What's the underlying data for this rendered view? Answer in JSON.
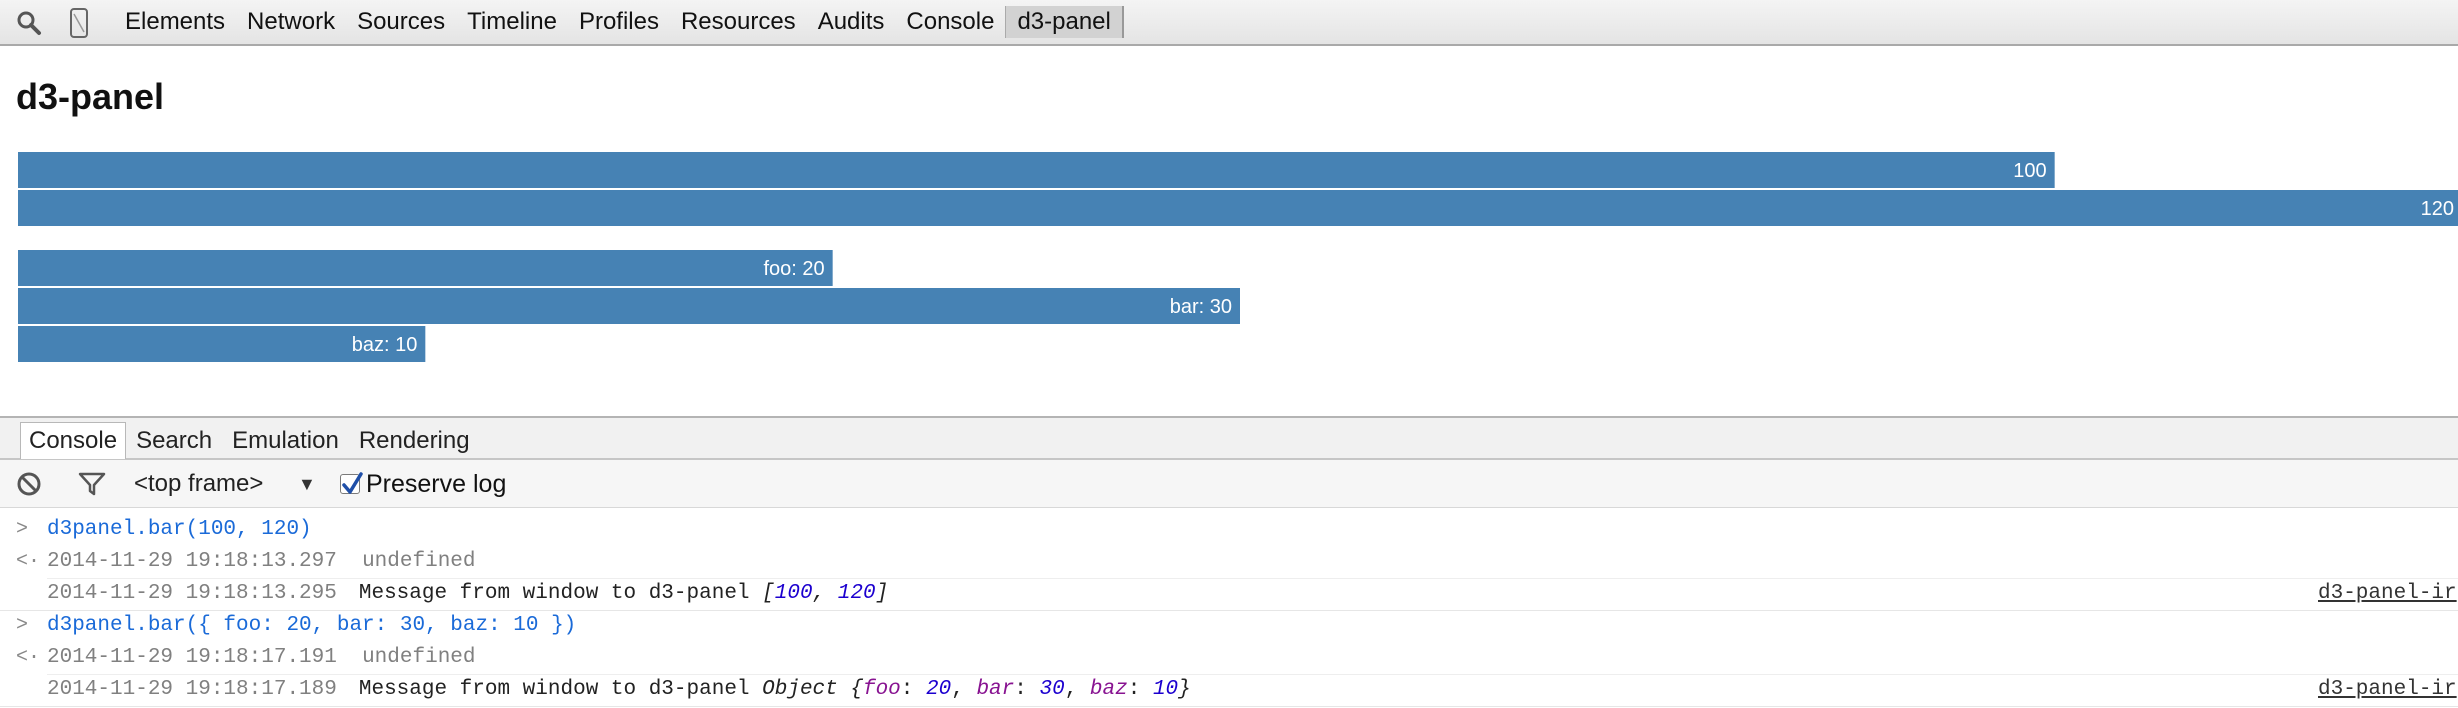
{
  "toolbar": {
    "icons": [
      "search-icon",
      "device-mode-icon"
    ],
    "tabs": [
      "Elements",
      "Network",
      "Sources",
      "Timeline",
      "Profiles",
      "Resources",
      "Audits",
      "Console",
      "d3-panel"
    ],
    "active_tab": "d3-panel"
  },
  "panel": {
    "title": "d3-panel"
  },
  "chart_data": [
    {
      "type": "bar",
      "orientation": "horizontal",
      "values": [
        100,
        120
      ],
      "labels": [
        "100",
        "120"
      ],
      "xlim": [
        0,
        120
      ],
      "bar_color": "#4682b4",
      "label_color": "#ffffff"
    },
    {
      "type": "bar",
      "orientation": "horizontal",
      "categories": [
        "foo",
        "bar",
        "baz"
      ],
      "values": [
        20,
        30,
        10
      ],
      "labels": [
        "foo: 20",
        "bar: 30",
        "baz: 10"
      ],
      "xlim": [
        0,
        60
      ],
      "bar_color": "#4682b4",
      "label_color": "#ffffff"
    }
  ],
  "drawer": {
    "tabs": [
      "Console",
      "Search",
      "Emulation",
      "Rendering"
    ],
    "active_tab": "Console"
  },
  "console_toolbar": {
    "clear_icon": "clear-console-icon",
    "filter_icon": "filter-icon",
    "frame_select": "<top frame>",
    "dropdown_arrow": "▼",
    "preserve_log_label": "Preserve log",
    "preserve_log_checked": true
  },
  "console": {
    "input_prompt": ">",
    "result_prompt": "<·",
    "messages": [
      {
        "kind": "input",
        "text": "d3panel.bar(100, 120)"
      },
      {
        "kind": "result",
        "timestamp": "2014-11-29 19:18:13.297",
        "text": "undefined"
      },
      {
        "kind": "log",
        "timestamp": "2014-11-29 19:18:13.295",
        "text": "Message from window to d3-panel",
        "arr_open": "[",
        "v1": "100",
        "comma": ", ",
        "v2": "120",
        "arr_close": "]",
        "source": "d3-panel-ir"
      },
      {
        "kind": "input",
        "text": "d3panel.bar({ foo: 20, bar: 30, baz: 10 })"
      },
      {
        "kind": "result",
        "timestamp": "2014-11-29 19:18:17.191",
        "text": "undefined"
      },
      {
        "kind": "log",
        "timestamp": "2014-11-29 19:18:17.189",
        "text": "Message from window to d3-panel",
        "obj_prefix": "Object {",
        "k1": "foo",
        "v1": "20",
        "k2": "bar",
        "v2": "30",
        "k3": "baz",
        "v3": "10",
        "obj_close": "}",
        "colon": ": ",
        "comma": ", ",
        "source": "d3-panel-ir"
      }
    ]
  },
  "colors": {
    "bar": "#4682b4",
    "console_input": "#1a6ad8",
    "console_number": "#1c00cf",
    "console_key": "#881391"
  }
}
